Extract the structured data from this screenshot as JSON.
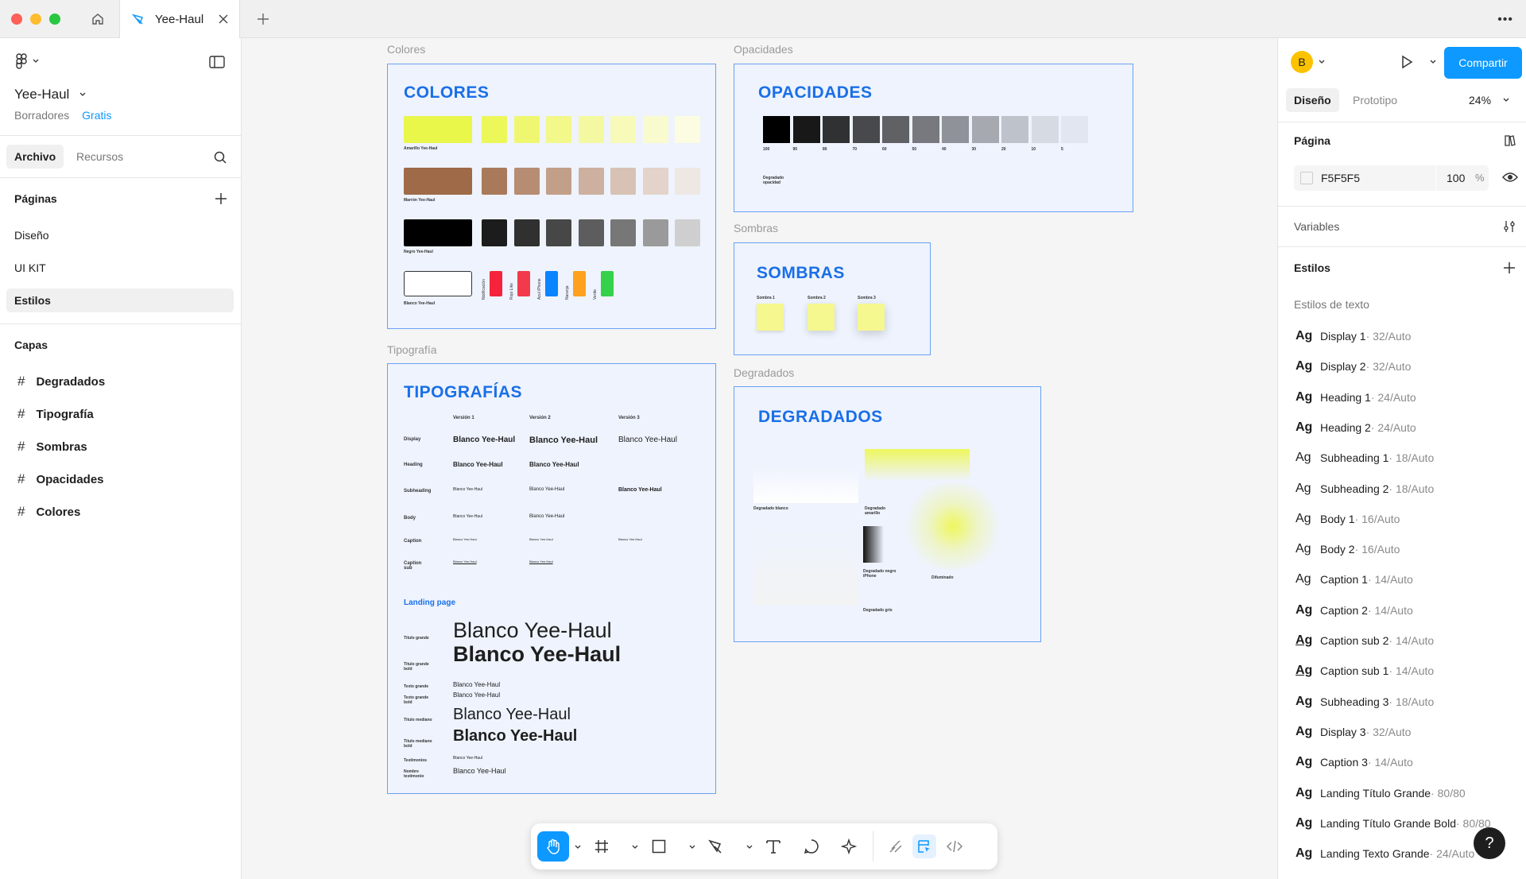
{
  "tab": {
    "title": "Yee-Haul"
  },
  "file": {
    "name": "Yee-Haul",
    "location": "Borradores",
    "plan": "Gratis"
  },
  "left_tabs": {
    "archivo": "Archivo",
    "recursos": "Recursos"
  },
  "pages": {
    "header": "Páginas",
    "items": [
      "Diseño",
      "UI KIT",
      "Estilos"
    ]
  },
  "layers": {
    "header": "Capas",
    "items": [
      "Degradados",
      "Tipografía",
      "Sombras",
      "Opacidades",
      "Colores"
    ]
  },
  "right": {
    "avatar": "B",
    "share": "Compartir",
    "tab_design": "Diseño",
    "tab_proto": "Prototipo",
    "zoom": "24%",
    "page_label": "Página",
    "page_color": "F5F5F5",
    "page_opacity": "100",
    "page_pct": "%",
    "variables": "Variables",
    "styles": "Estilos",
    "text_styles": "Estilos de texto",
    "style_items": [
      {
        "name": "Display 1",
        "meta": " · 32/Auto"
      },
      {
        "name": "Display 2",
        "meta": " · 32/Auto"
      },
      {
        "name": "Heading 1",
        "meta": " · 24/Auto"
      },
      {
        "name": "Heading 2",
        "meta": " · 24/Auto"
      },
      {
        "name": "Subheading 1",
        "meta": " · 18/Auto"
      },
      {
        "name": "Subheading 2",
        "meta": " · 18/Auto"
      },
      {
        "name": "Body 1",
        "meta": " · 16/Auto"
      },
      {
        "name": "Body 2",
        "meta": " · 16/Auto"
      },
      {
        "name": "Caption 1",
        "meta": " · 14/Auto"
      },
      {
        "name": "Caption 2",
        "meta": " · 14/Auto"
      },
      {
        "name": "Caption sub 2",
        "meta": " · 14/Auto"
      },
      {
        "name": "Caption sub 1",
        "meta": " · 14/Auto"
      },
      {
        "name": "Subheading 3",
        "meta": " · 18/Auto"
      },
      {
        "name": "Display 3",
        "meta": " · 32/Auto"
      },
      {
        "name": "Caption 3",
        "meta": " · 14/Auto"
      },
      {
        "name": "Landing Título Grande",
        "meta": " · 80/80"
      },
      {
        "name": "Landing Título Grande Bold",
        "meta": " · 80/80"
      },
      {
        "name": "Landing Texto Grande",
        "meta": " · 24/Auto"
      }
    ],
    "help": "?"
  },
  "canvas": {
    "labels": {
      "colores": "Colores",
      "opacidades": "Opacidades",
      "sombras": "Sombras",
      "tipografia": "Tipografía",
      "degradados": "Degradados"
    },
    "colores": {
      "title": "COLORES",
      "rows": [
        "Amarillo Yee-Haul",
        "Marrón Yee-Haul",
        "Negro Yee-Haul",
        "Blanco Yee-Haul"
      ],
      "extras": [
        "Notificación",
        "Rojo Like",
        "Azul iPhone",
        "Naranja",
        "Verde"
      ],
      "yellow": [
        "#e9f74b",
        "#ecf75a",
        "#eff770",
        "#f2f889",
        "#f4f9a1",
        "#f7fab8",
        "#f9fbcf",
        "#fbfce2"
      ],
      "brown": [
        "#9e6a48",
        "#a87a5b",
        "#b68d73",
        "#c29f89",
        "#cdb09f",
        "#d7c2b5",
        "#e3d3ca",
        "#efe7e2"
      ],
      "black": [
        "#000000",
        "#1c1c1c",
        "#303030",
        "#474747",
        "#5d5d5d",
        "#777777",
        "#9a9a9a",
        "#cfcfcf"
      ],
      "accents": [
        "#f5233b",
        "#f23a4c",
        "#0a84ff",
        "#ffa01e",
        "#35d14a"
      ]
    },
    "opacidades": {
      "title": "OPACIDADES",
      "values": [
        "100",
        "90",
        "80",
        "70",
        "60",
        "50",
        "40",
        "30",
        "20",
        "10",
        "5"
      ],
      "note": "Degradado opacidad"
    },
    "sombras": {
      "title": "SOMBRAS",
      "items": [
        "Sombra 1",
        "Sombra 2",
        "Sombra 3"
      ]
    },
    "tipografias": {
      "title": "TIPOGRAFÍAS",
      "versions": [
        "Versión 1",
        "Versión 2",
        "Versión 3"
      ],
      "rows": [
        "Display",
        "Heading",
        "Subheading",
        "Body",
        "Caption",
        "Caption sub"
      ],
      "sample": "Blanco Yee-Haul",
      "landing": "Landing page",
      "landing_rows": [
        "Título grande",
        "Título grande bold",
        "Texto grande",
        "Texto grande bold",
        "Título mediano",
        "Título mediano bold",
        "Testimonios",
        "Nombre testimonio"
      ]
    },
    "degradados": {
      "title": "DEGRADADOS",
      "items": [
        "Degradado blanco",
        "Degradado amarillo",
        "Degradado negro iPhone",
        "Difuminado",
        "Degradado gris"
      ]
    }
  },
  "colors": {
    "accent": "#0d99ff",
    "frame_title": "#1a6fe8",
    "frame_border": "#6aa1f3"
  }
}
